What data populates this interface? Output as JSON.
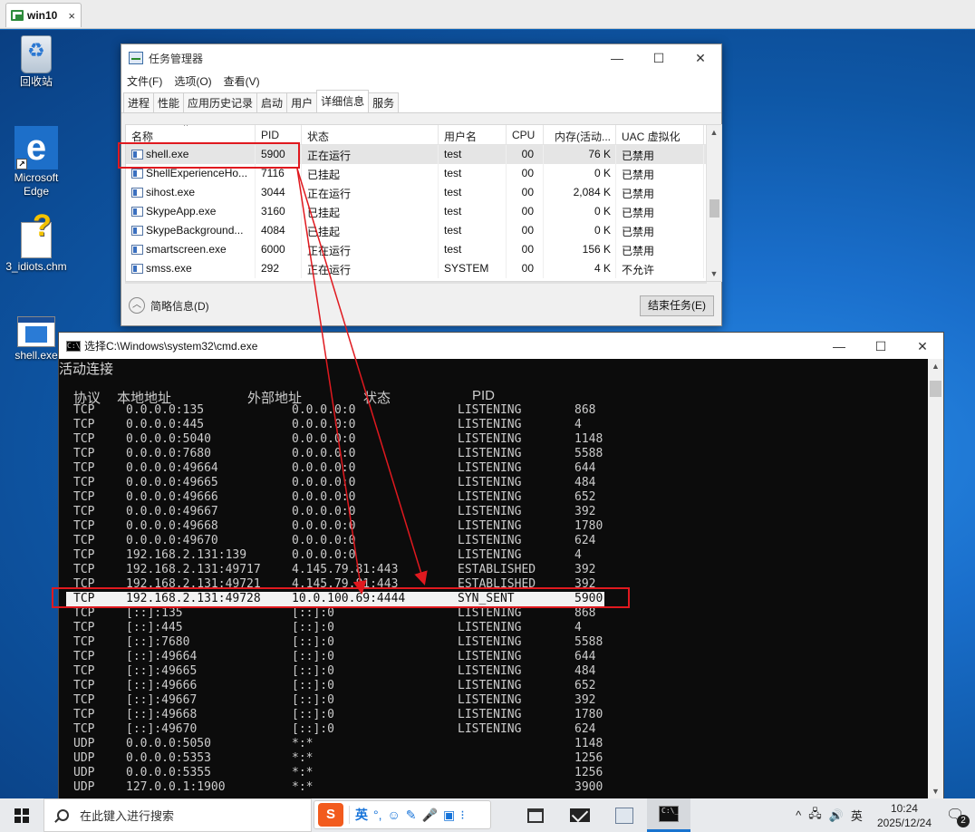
{
  "vm": {
    "tab_label": "win10",
    "close": "×"
  },
  "desktop_icons": [
    {
      "label": "回收站"
    },
    {
      "label": "Microsoft Edge"
    },
    {
      "label": "3_idiots.chm"
    },
    {
      "label": "shell.exe"
    }
  ],
  "task_manager": {
    "title": "任务管理器",
    "window_buttons": [
      "—",
      "☐",
      "✕"
    ],
    "menu": [
      "文件(F)",
      "选项(O)",
      "查看(V)"
    ],
    "tabs": [
      "进程",
      "性能",
      "应用历史记录",
      "启动",
      "用户",
      "详细信息",
      "服务"
    ],
    "active_tab": "详细信息",
    "columns": [
      "名称",
      "PID",
      "状态",
      "用户名",
      "CPU",
      "内存(活动...",
      "UAC 虚拟化"
    ],
    "rows": [
      {
        "name": "shell.exe",
        "pid": "5900",
        "status": "正在运行",
        "user": "test",
        "cpu": "00",
        "mem": "76 K",
        "uac": "已禁用"
      },
      {
        "name": "ShellExperienceHo...",
        "pid": "7116",
        "status": "已挂起",
        "user": "test",
        "cpu": "00",
        "mem": "0 K",
        "uac": "已禁用"
      },
      {
        "name": "sihost.exe",
        "pid": "3044",
        "status": "正在运行",
        "user": "test",
        "cpu": "00",
        "mem": "2,084 K",
        "uac": "已禁用"
      },
      {
        "name": "SkypeApp.exe",
        "pid": "3160",
        "status": "已挂起",
        "user": "test",
        "cpu": "00",
        "mem": "0 K",
        "uac": "已禁用"
      },
      {
        "name": "SkypeBackground...",
        "pid": "4084",
        "status": "已挂起",
        "user": "test",
        "cpu": "00",
        "mem": "0 K",
        "uac": "已禁用"
      },
      {
        "name": "smartscreen.exe",
        "pid": "6000",
        "status": "正在运行",
        "user": "test",
        "cpu": "00",
        "mem": "156 K",
        "uac": "已禁用"
      },
      {
        "name": "smss.exe",
        "pid": "292",
        "status": "正在运行",
        "user": "SYSTEM",
        "cpu": "00",
        "mem": "4 K",
        "uac": "不允许"
      }
    ],
    "fewer_details": "简略信息(D)",
    "end_task": "结束任务(E)"
  },
  "cmd": {
    "title": "选择C:\\Windows\\system32\\cmd.exe",
    "window_buttons": [
      "—",
      "☐",
      "✕"
    ],
    "heading": "活动连接",
    "col_proto": "协议",
    "col_local": "本地地址",
    "col_foreign": "外部地址",
    "col_state": "状态",
    "col_pid": "PID",
    "highlight_index": 13,
    "lines": [
      {
        "proto": "TCP",
        "local": "0.0.0.0:135",
        "foreign": "0.0.0.0:0",
        "state": "LISTENING",
        "pid": "868"
      },
      {
        "proto": "TCP",
        "local": "0.0.0.0:445",
        "foreign": "0.0.0.0:0",
        "state": "LISTENING",
        "pid": "4"
      },
      {
        "proto": "TCP",
        "local": "0.0.0.0:5040",
        "foreign": "0.0.0.0:0",
        "state": "LISTENING",
        "pid": "1148"
      },
      {
        "proto": "TCP",
        "local": "0.0.0.0:7680",
        "foreign": "0.0.0.0:0",
        "state": "LISTENING",
        "pid": "5588"
      },
      {
        "proto": "TCP",
        "local": "0.0.0.0:49664",
        "foreign": "0.0.0.0:0",
        "state": "LISTENING",
        "pid": "644"
      },
      {
        "proto": "TCP",
        "local": "0.0.0.0:49665",
        "foreign": "0.0.0.0:0",
        "state": "LISTENING",
        "pid": "484"
      },
      {
        "proto": "TCP",
        "local": "0.0.0.0:49666",
        "foreign": "0.0.0.0:0",
        "state": "LISTENING",
        "pid": "652"
      },
      {
        "proto": "TCP",
        "local": "0.0.0.0:49667",
        "foreign": "0.0.0.0:0",
        "state": "LISTENING",
        "pid": "392"
      },
      {
        "proto": "TCP",
        "local": "0.0.0.0:49668",
        "foreign": "0.0.0.0:0",
        "state": "LISTENING",
        "pid": "1780"
      },
      {
        "proto": "TCP",
        "local": "0.0.0.0:49670",
        "foreign": "0.0.0.0:0",
        "state": "LISTENING",
        "pid": "624"
      },
      {
        "proto": "TCP",
        "local": "192.168.2.131:139",
        "foreign": "0.0.0.0:0",
        "state": "LISTENING",
        "pid": "4"
      },
      {
        "proto": "TCP",
        "local": "192.168.2.131:49717",
        "foreign": "4.145.79.81:443",
        "state": "ESTABLISHED",
        "pid": "392"
      },
      {
        "proto": "TCP",
        "local": "192.168.2.131:49721",
        "foreign": "4.145.79.81:443",
        "state": "ESTABLISHED",
        "pid": "392"
      },
      {
        "proto": "TCP",
        "local": "192.168.2.131:49728",
        "foreign": "10.0.100.69:4444",
        "state": "SYN_SENT",
        "pid": "5900"
      },
      {
        "proto": "TCP",
        "local": "[::]:135",
        "foreign": "[::]:0",
        "state": "LISTENING",
        "pid": "868"
      },
      {
        "proto": "TCP",
        "local": "[::]:445",
        "foreign": "[::]:0",
        "state": "LISTENING",
        "pid": "4"
      },
      {
        "proto": "TCP",
        "local": "[::]:7680",
        "foreign": "[::]:0",
        "state": "LISTENING",
        "pid": "5588"
      },
      {
        "proto": "TCP",
        "local": "[::]:49664",
        "foreign": "[::]:0",
        "state": "LISTENING",
        "pid": "644"
      },
      {
        "proto": "TCP",
        "local": "[::]:49665",
        "foreign": "[::]:0",
        "state": "LISTENING",
        "pid": "484"
      },
      {
        "proto": "TCP",
        "local": "[::]:49666",
        "foreign": "[::]:0",
        "state": "LISTENING",
        "pid": "652"
      },
      {
        "proto": "TCP",
        "local": "[::]:49667",
        "foreign": "[::]:0",
        "state": "LISTENING",
        "pid": "392"
      },
      {
        "proto": "TCP",
        "local": "[::]:49668",
        "foreign": "[::]:0",
        "state": "LISTENING",
        "pid": "1780"
      },
      {
        "proto": "TCP",
        "local": "[::]:49670",
        "foreign": "[::]:0",
        "state": "LISTENING",
        "pid": "624"
      },
      {
        "proto": "UDP",
        "local": "0.0.0.0:5050",
        "foreign": "*:*",
        "state": "",
        "pid": "1148"
      },
      {
        "proto": "UDP",
        "local": "0.0.0.0:5353",
        "foreign": "*:*",
        "state": "",
        "pid": "1256"
      },
      {
        "proto": "UDP",
        "local": "0.0.0.0:5355",
        "foreign": "*:*",
        "state": "",
        "pid": "1256"
      },
      {
        "proto": "UDP",
        "local": "127.0.0.1:1900",
        "foreign": "*:*",
        "state": "",
        "pid": "3900"
      }
    ]
  },
  "taskbar": {
    "search_placeholder": "在此键入进行搜索",
    "ime": {
      "logo": "S",
      "mode": "英",
      "punct": "°,",
      "icons": [
        "☺",
        "✎",
        "🎤",
        "▣",
        "⁝"
      ]
    },
    "tray_caret": "^",
    "tray_net": "🖧",
    "tray_vol": "🔊",
    "tray_lang": "英",
    "time": "10:24",
    "date": "2025/12/24",
    "notification_count": "2"
  },
  "annotation_color": "#e0191f"
}
